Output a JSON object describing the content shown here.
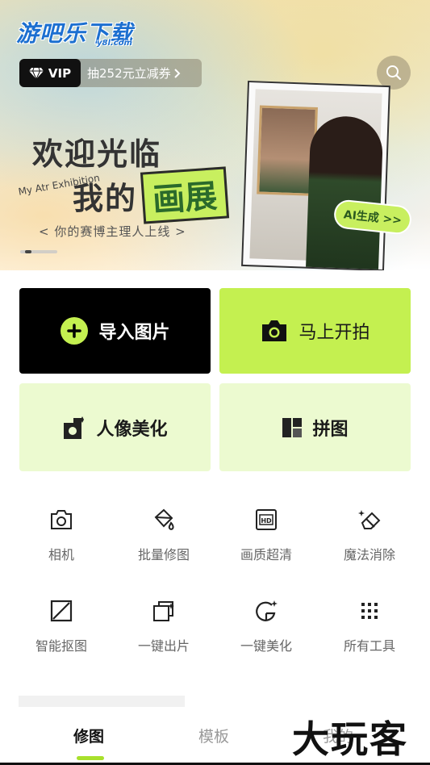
{
  "logo": {
    "chinese": "游吧乐下载",
    "site": "y8l.com"
  },
  "vip": {
    "badge_label": "VIP",
    "promo_text": "抽252元立减券"
  },
  "banner": {
    "headline": "欢迎光临",
    "subhead_a": "我的",
    "subhead_b": "画展",
    "side_text": "My Atr Exhibition",
    "tagline": "< 你的赛博主理人上线 >",
    "ai_tag": "AI生成 >>"
  },
  "tiles": {
    "import": "导入图片",
    "shoot": "马上开拍",
    "portrait": "人像美化",
    "collage": "拼图"
  },
  "tools": [
    {
      "label": "相机",
      "icon": "camera-icon"
    },
    {
      "label": "批量修图",
      "icon": "paint-bucket-icon"
    },
    {
      "label": "画质超清",
      "icon": "hd-icon"
    },
    {
      "label": "魔法消除",
      "icon": "eraser-icon"
    },
    {
      "label": "智能抠图",
      "icon": "cutout-icon"
    },
    {
      "label": "一键出片",
      "icon": "photo-stack-icon"
    },
    {
      "label": "一键美化",
      "icon": "magic-g-icon"
    },
    {
      "label": "所有工具",
      "icon": "grid-dots-icon"
    }
  ],
  "tabs": {
    "retouch": "修图",
    "template": "模板",
    "mine": "我的"
  },
  "watermark": "大玩客",
  "colors": {
    "accent": "#c4f050",
    "accent_light": "#ecfad0",
    "dark": "#000000"
  }
}
